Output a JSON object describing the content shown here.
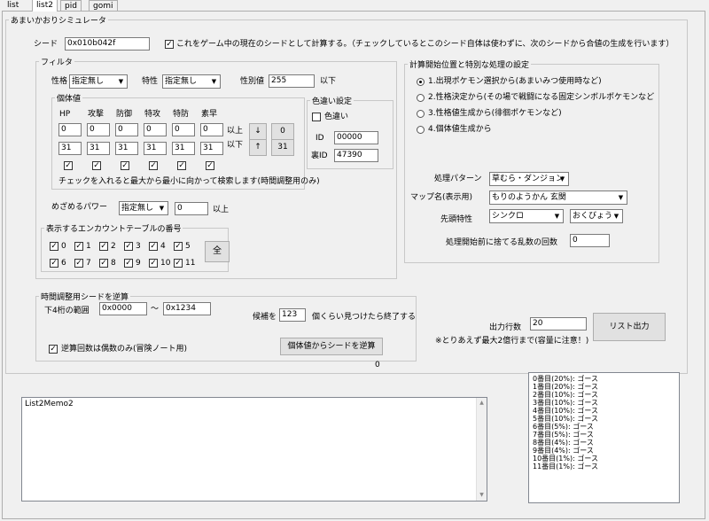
{
  "tabs": [
    "list",
    "list2",
    "pid",
    "gomi"
  ],
  "active_tab": 1,
  "main_group": "あまいかおりシミュレータ",
  "seed": {
    "label": "シード",
    "value": "0x010b042f",
    "chk_label": "これをゲーム中の現在のシードとして計算する。（チェックしているとこのシード自体は使わずに、次のシードから合値の生成を行います）",
    "chk": true
  },
  "filter": {
    "title": "フィルタ",
    "nature_label": "性格",
    "nature_value": "指定無し",
    "ability_label": "特性",
    "ability_value": "指定無し",
    "gender_label": "性別値",
    "gender_value": "255",
    "gender_suffix": "以下",
    "iv_title": "個体値",
    "iv_headers": [
      "HP",
      "攻撃",
      "防御",
      "特攻",
      "特防",
      "素早"
    ],
    "iv_min": [
      "0",
      "0",
      "0",
      "0",
      "0",
      "0"
    ],
    "iv_max": [
      "31",
      "31",
      "31",
      "31",
      "31",
      "31"
    ],
    "above": "以上",
    "below": "以下",
    "down_arrow": "↓",
    "up_arrow": "↑",
    "set0": "0",
    "set31": "31",
    "iv_note": "チェックを入れると最大から最小に向かって検索します(時間調整用のみ)",
    "shiny_title": "色違い設定",
    "shiny_chk": "色違い",
    "id_label": "ID",
    "id_value": "00000",
    "sid_label": "裏ID",
    "sid_value": "47390",
    "hp_label": "めざめるパワー",
    "hp_type": "指定無し",
    "hp_power": "0",
    "hp_suffix": "以上",
    "enc_title": "表示するエンカウントテーブルの番号",
    "enc_row1": [
      "0",
      "1",
      "2",
      "3",
      "4",
      "5"
    ],
    "enc_row2": [
      "6",
      "7",
      "8",
      "9",
      "10",
      "11"
    ],
    "all_btn": "全"
  },
  "calc": {
    "title": "計算開始位置と特別な処理の設定",
    "options": [
      "1.出現ポケモン選択から(あまいみつ使用時など)",
      "2.性格決定から(その場で戦闘になる固定シンボルポケモンなど",
      "3.性格値生成から(徘徊ポケモンなど)",
      "4.個体値生成から"
    ],
    "selected": 0,
    "pattern_label": "処理パターン",
    "pattern_value": "草むら・ダンジョン",
    "map_label": "マップ名(表示用)",
    "map_value": "もりのようかん 玄関",
    "lead_label": "先頭特性",
    "lead_value": "シンクロ",
    "lead_nature": "おくびょう",
    "discard_label": "処理開始前に捨てる乱数の回数",
    "discard_value": "0"
  },
  "time": {
    "title": "時間調整用シードを逆算",
    "range_label": "下4桁の範囲",
    "from": "0x0000",
    "tilde": "〜",
    "to": "0x1234",
    "cand_prefix": "候補を",
    "cand_value": "123",
    "cand_suffix": "個くらい見つけたら終了する",
    "even_chk": "逆算回数は偶数のみ(冒険ノート用)",
    "button": "個体値からシードを逆算",
    "count": "0"
  },
  "output": {
    "label": "出力行数",
    "value": "20",
    "note": "※とりあえず最大2億行まで(容量に注意！)",
    "button": "リスト出力"
  },
  "memo_text": "List2Memo2",
  "results": [
    "0番目(20%): ゴース",
    "1番目(20%): ゴース",
    "2番目(10%): ゴース",
    "3番目(10%): ゴース",
    "4番目(10%): ゴース",
    "5番目(10%): ゴース",
    "6番目(5%): ゴース",
    "7番目(5%): ゴース",
    "8番目(4%): ゴース",
    "9番目(4%): ゴース",
    "10番目(1%): ゴース",
    "11番目(1%): ゴース"
  ]
}
